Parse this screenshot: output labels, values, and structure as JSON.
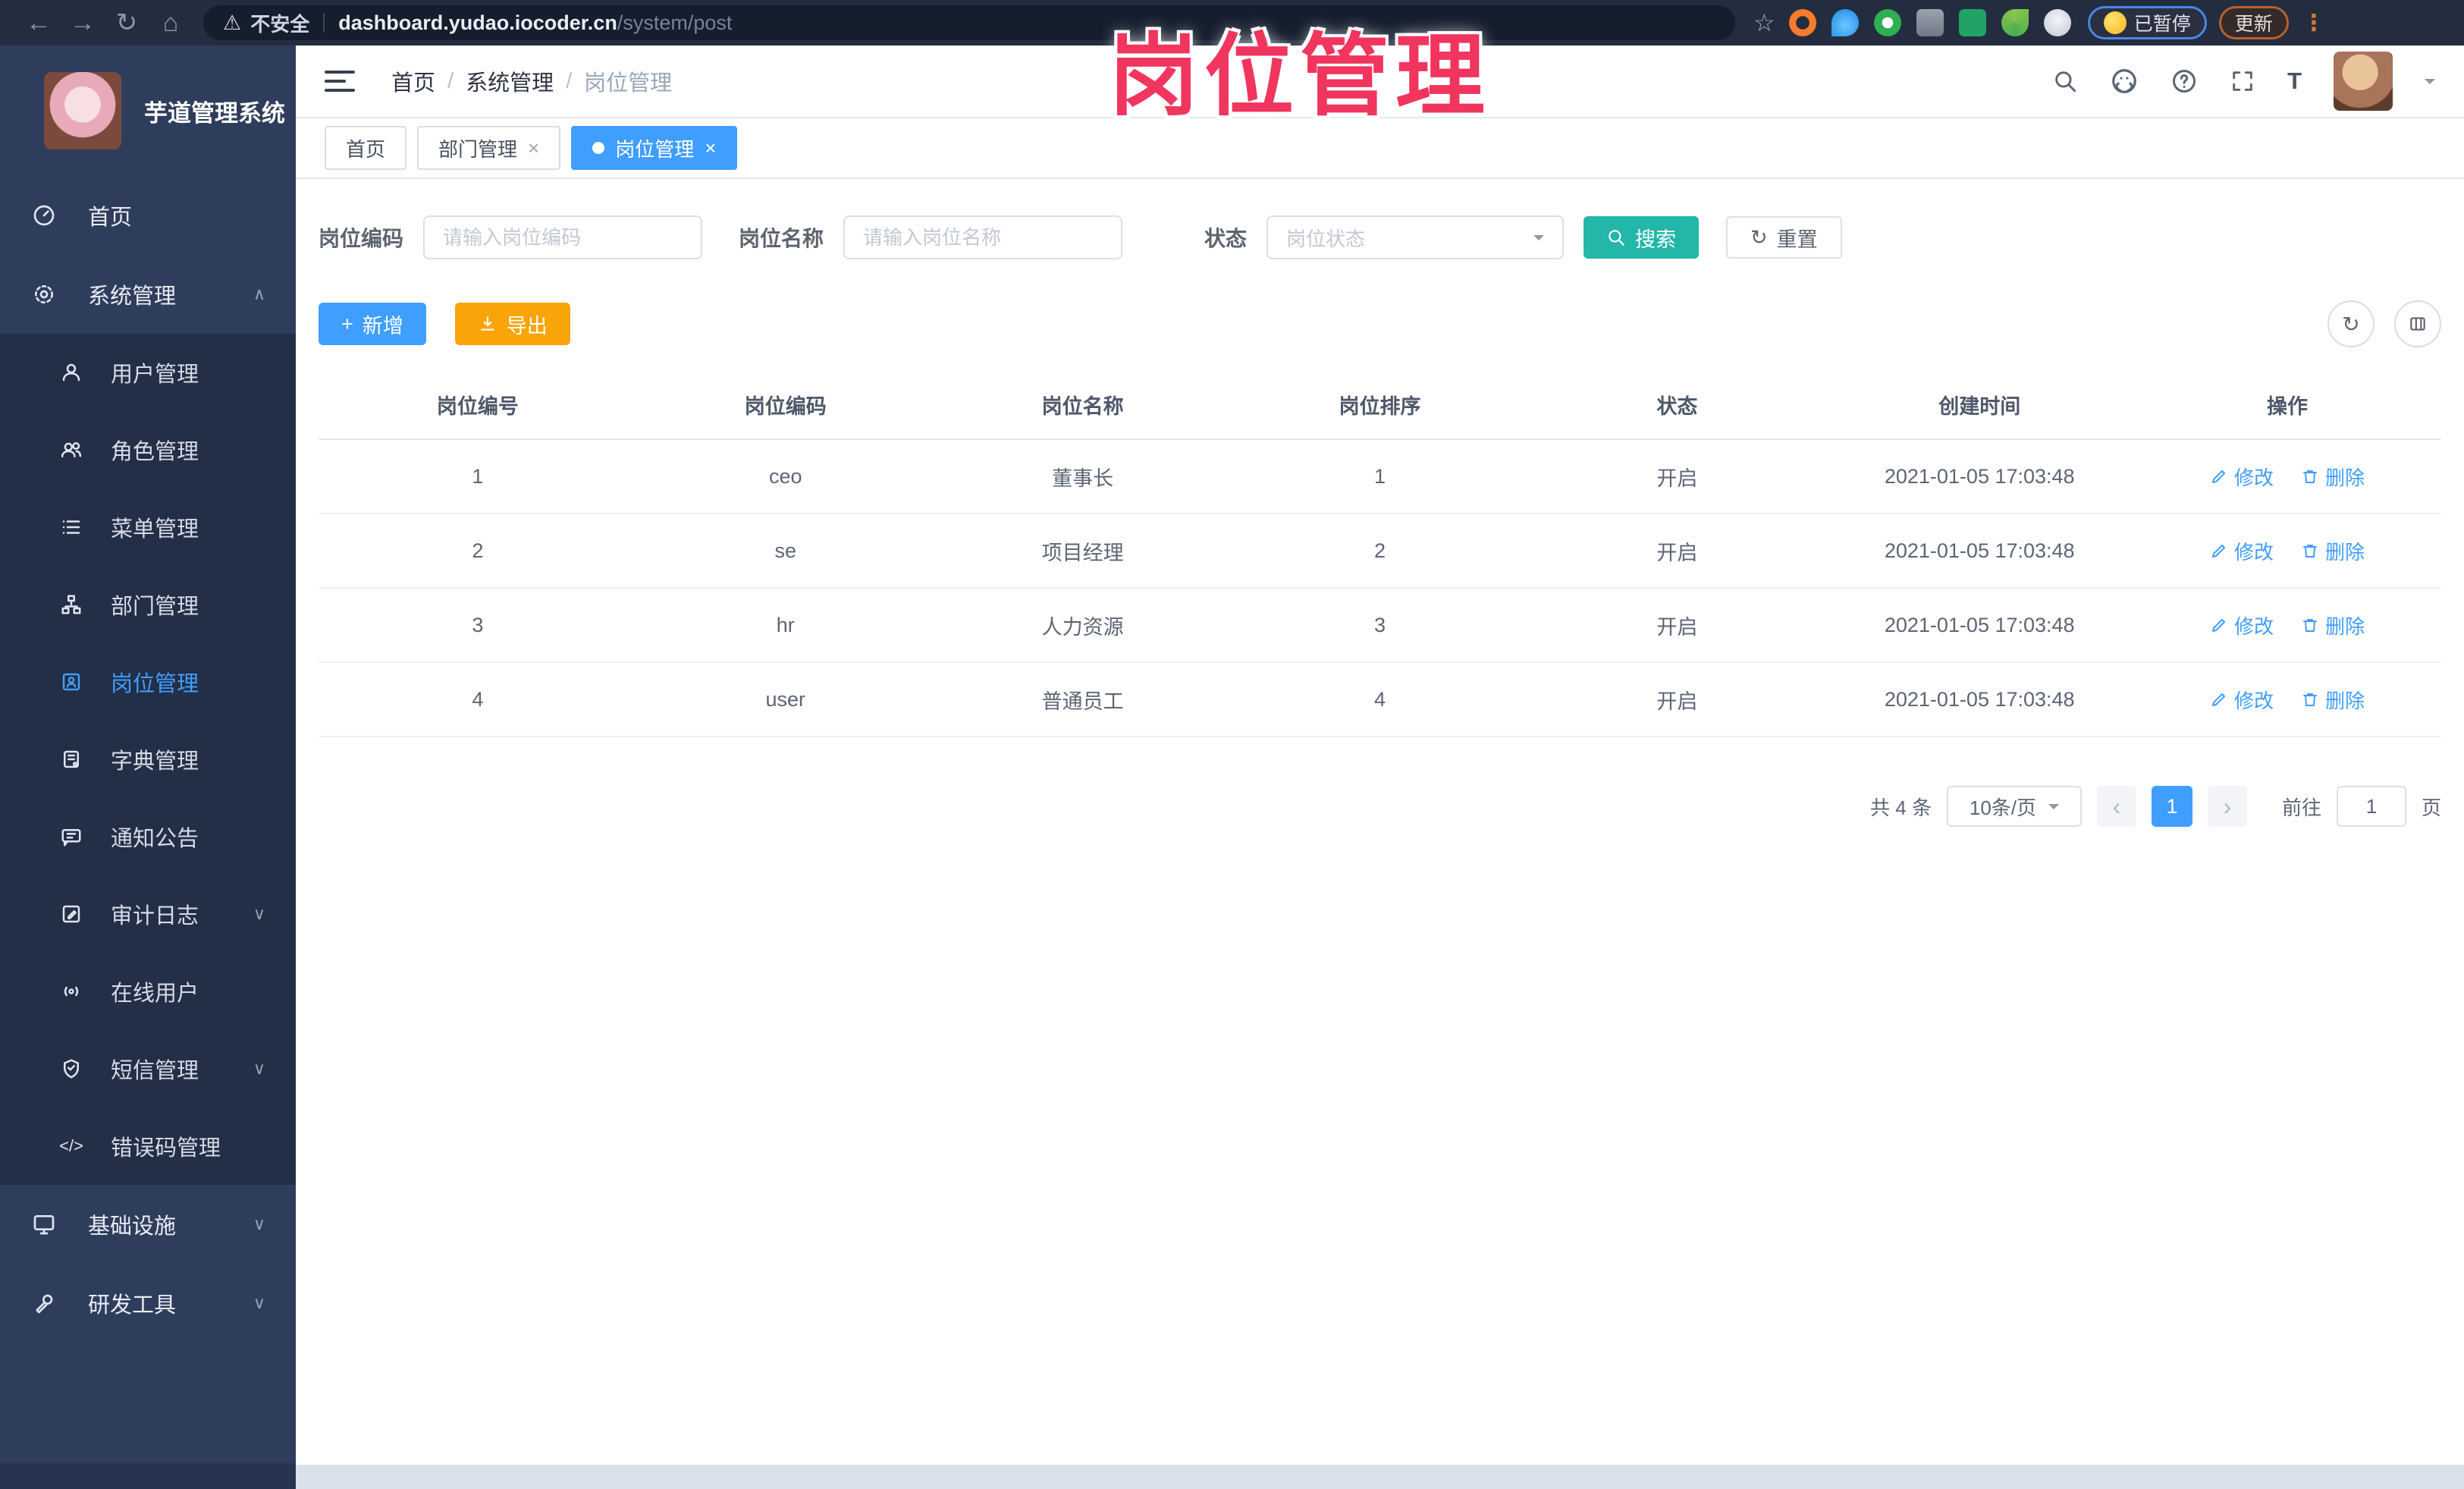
{
  "browser": {
    "security_label": "不安全",
    "url_host": "dashboard.yudao.iocoder.cn",
    "url_path": "/system/post",
    "paused_label": "已暂停",
    "update_label": "更新"
  },
  "icons": {
    "back": "←",
    "forward": "→",
    "reload": "↻",
    "home": "⌂",
    "warning": "⚠",
    "star": "☆",
    "kebab": "⋮",
    "close": "×",
    "chevron_up": "∧",
    "chevron_down": "∨",
    "plus": "+",
    "refresh": "↻",
    "prev": "‹",
    "next": "›",
    "code": "</>",
    "font_size": "T"
  },
  "watermark": "岗位管理",
  "sidebar": {
    "title": "芋道管理系统",
    "home_label": "首页",
    "system_label": "系统管理",
    "system_children": [
      {
        "label": "用户管理"
      },
      {
        "label": "角色管理"
      },
      {
        "label": "菜单管理"
      },
      {
        "label": "部门管理"
      },
      {
        "label": "岗位管理"
      },
      {
        "label": "字典管理"
      },
      {
        "label": "通知公告"
      },
      {
        "label": "审计日志"
      },
      {
        "label": "在线用户"
      },
      {
        "label": "短信管理"
      },
      {
        "label": "错误码管理"
      }
    ],
    "infra_label": "基础设施",
    "devtool_label": "研发工具"
  },
  "header": {
    "breadcrumb": {
      "items": [
        "首页",
        "系统管理",
        "岗位管理"
      ],
      "separator": "/"
    }
  },
  "tabs": [
    {
      "label": "首页"
    },
    {
      "label": "部门管理"
    },
    {
      "label": "岗位管理"
    }
  ],
  "filters": {
    "code_label": "岗位编码",
    "code_placeholder": "请输入岗位编码",
    "name_label": "岗位名称",
    "name_placeholder": "请输入岗位名称",
    "status_label": "状态",
    "status_placeholder": "岗位状态",
    "search_label": "搜索",
    "reset_label": "重置"
  },
  "toolbar": {
    "add_label": "新增",
    "export_label": "导出"
  },
  "table": {
    "columns": [
      "岗位编号",
      "岗位编码",
      "岗位名称",
      "岗位排序",
      "状态",
      "创建时间",
      "操作"
    ],
    "edit_label": "修改",
    "delete_label": "删除",
    "rows": [
      {
        "id": "1",
        "code": "ceo",
        "name": "董事长",
        "sort": "1",
        "status": "开启",
        "created": "2021-01-05 17:03:48"
      },
      {
        "id": "2",
        "code": "se",
        "name": "项目经理",
        "sort": "2",
        "status": "开启",
        "created": "2021-01-05 17:03:48"
      },
      {
        "id": "3",
        "code": "hr",
        "name": "人力资源",
        "sort": "3",
        "status": "开启",
        "created": "2021-01-05 17:03:48"
      },
      {
        "id": "4",
        "code": "user",
        "name": "普通员工",
        "sort": "4",
        "status": "开启",
        "created": "2021-01-05 17:03:48"
      }
    ]
  },
  "pagination": {
    "total_label": "共 4 条",
    "page_size_label": "10条/页",
    "current_page": "1",
    "goto_label": "前往",
    "goto_value": "1",
    "page_suffix": "页"
  },
  "colors": {
    "accent": "#409eff",
    "search_teal": "#23b7a9",
    "export_orange": "#f9a408",
    "watermark_pink": "#f0355e",
    "sidebar_bg": "#2f3d5c",
    "submenu_bg": "#232e47",
    "browser_bar_bg": "#232d3f"
  }
}
